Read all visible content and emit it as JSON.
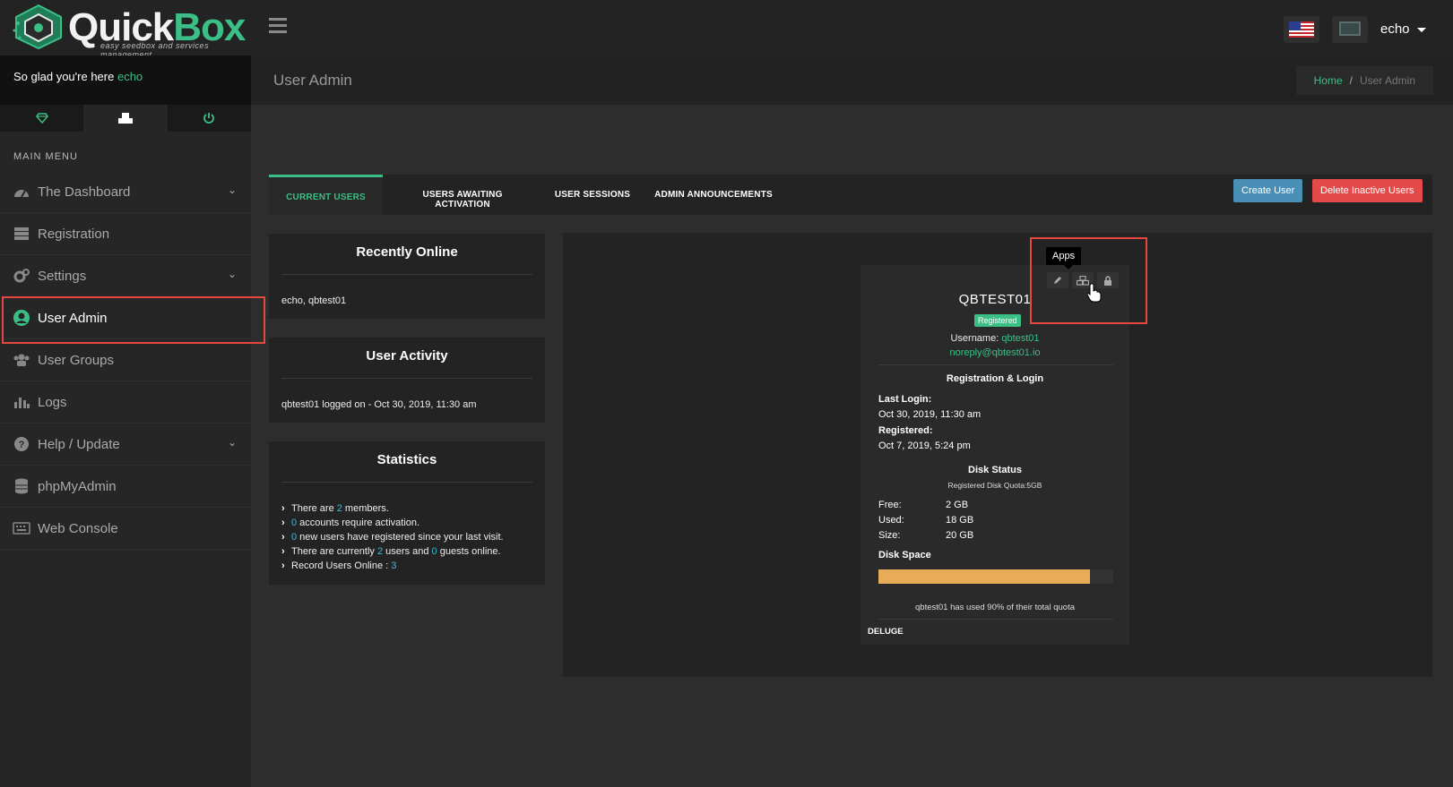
{
  "brand": {
    "name_part1": "Quick",
    "name_part2": "Box",
    "tagline": "easy seedbox and services management"
  },
  "topbar": {
    "username": "echo",
    "flag": "us-flag-icon",
    "monitor": "monitor-icon"
  },
  "sidebar": {
    "welcome_text": "So glad you're here",
    "welcome_name": "echo",
    "tabs": [
      "diamond-icon",
      "apps-icon",
      "power-icon"
    ],
    "menu_label": "MAIN MENU",
    "items": [
      {
        "label": "The Dashboard",
        "icon": "dashboard-icon",
        "expandable": true
      },
      {
        "label": "Registration",
        "icon": "registration-icon",
        "expandable": false
      },
      {
        "label": "Settings",
        "icon": "settings-icon",
        "expandable": true
      },
      {
        "label": "User Admin",
        "icon": "user-admin-icon",
        "expandable": false,
        "active": true
      },
      {
        "label": "User Groups",
        "icon": "user-groups-icon",
        "expandable": false
      },
      {
        "label": "Logs",
        "icon": "logs-icon",
        "expandable": false
      },
      {
        "label": "Help / Update",
        "icon": "help-icon",
        "expandable": true
      },
      {
        "label": "phpMyAdmin",
        "icon": "database-icon",
        "expandable": false
      },
      {
        "label": "Web Console",
        "icon": "keyboard-icon",
        "expandable": false
      }
    ]
  },
  "header": {
    "title": "User Admin",
    "breadcrumb_home": "Home",
    "breadcrumb_sep": "/",
    "breadcrumb_current": "User Admin"
  },
  "tabs": {
    "current_users": "CURRENT USERS",
    "awaiting": "USERS AWAITING ACTIVATION",
    "sessions": "USER SESSIONS",
    "announcements": "ADMIN ANNOUNCEMENTS",
    "create_user": "Create User",
    "delete_inactive": "Delete Inactive Users"
  },
  "recently_online": {
    "title": "Recently Online",
    "text": "echo, qbtest01"
  },
  "user_activity": {
    "title": "User Activity",
    "text": "qbtest01 logged on - Oct 30, 2019, 11:30 am"
  },
  "statistics": {
    "title": "Statistics",
    "l1a": "There are ",
    "l1n": "2",
    "l1b": " members.",
    "l2n": "0",
    "l2b": " accounts require activation.",
    "l3n": "0",
    "l3b": " new users have registered since your last visit.",
    "l4a": "There are currently ",
    "l4n1": "2",
    "l4b": " users and ",
    "l4n2": "0",
    "l4c": " guests online.",
    "l5a": "Record Users Online : ",
    "l5n": "3"
  },
  "user_card": {
    "tooltip": "Apps",
    "name": "QBTEST01",
    "badge": "Registered",
    "username_label": "Username: ",
    "username": "qbtest01",
    "email": "noreply@qbtest01.io",
    "reg_title": "Registration & Login",
    "last_login_label": "Last Login:",
    "last_login": "Oct 30, 2019, 11:30 am",
    "registered_label": "Registered:",
    "registered": "Oct 7, 2019, 5:24 pm",
    "disk_title": "Disk Status",
    "quota": "Registered Disk Quota:5GB",
    "free_label": "Free:",
    "free": "2 GB",
    "used_label": "Used:",
    "used": "18 GB",
    "size_label": "Size:",
    "size": "20 GB",
    "disk_space_label": "Disk Space",
    "disk_used_fraction": 0.9,
    "usage_note": "qbtest01 has used 90% of their total quota",
    "app": "DELUGE"
  },
  "colors": {
    "accent": "#3cbf86",
    "danger": "#e54a4a",
    "primary": "#4a8fb5",
    "bar": "#e8ac58",
    "highlight": "#e5483f"
  }
}
